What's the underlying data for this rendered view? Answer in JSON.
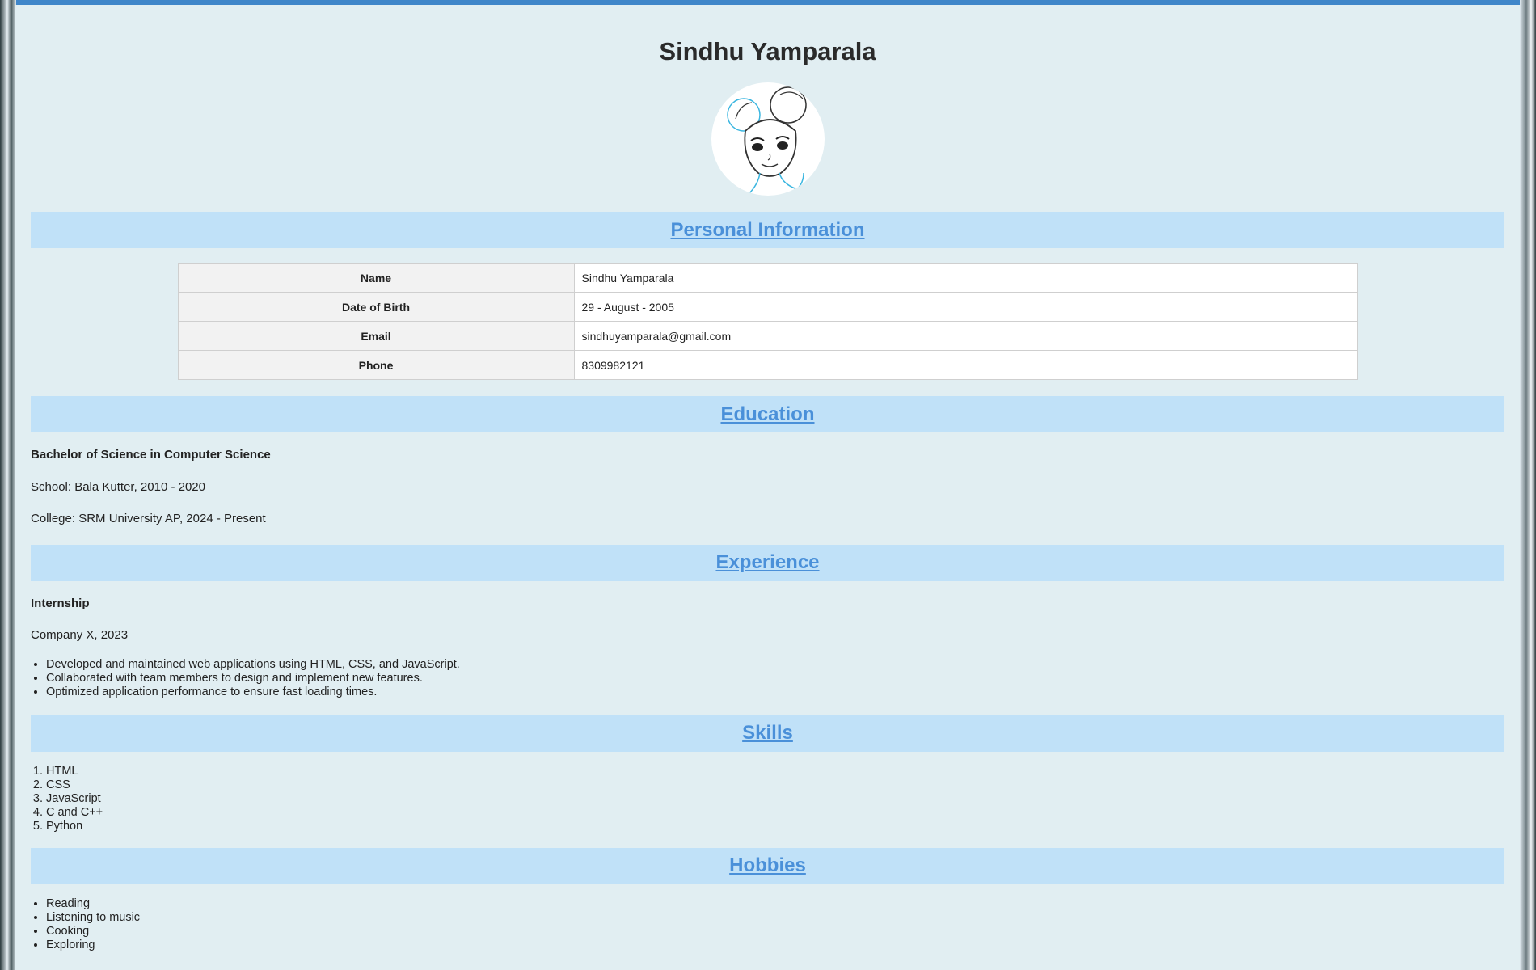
{
  "name": "Sindhu Yamparala",
  "sections": {
    "personal": "Personal Information",
    "education": "Education",
    "experience": "Experience",
    "skills": "Skills",
    "hobbies": "Hobbies"
  },
  "personal_info": [
    {
      "label": "Name",
      "value": "Sindhu Yamparala"
    },
    {
      "label": "Date of Birth",
      "value": "29 - August - 2005"
    },
    {
      "label": "Email",
      "value": "sindhuyamparala@gmail.com"
    },
    {
      "label": "Phone",
      "value": "8309982121"
    }
  ],
  "education": {
    "degree": "Bachelor of Science in Computer Science",
    "school": "School: Bala Kutter, 2010 - 2020",
    "college": "College: SRM University AP, 2024 - Present"
  },
  "experience": {
    "title": "Internship",
    "company": "Company X, 2023",
    "points": [
      "Developed and maintained web applications using HTML, CSS, and JavaScript.",
      "Collaborated with team members to design and implement new features.",
      "Optimized application performance to ensure fast loading times."
    ]
  },
  "skills": [
    "HTML",
    "CSS",
    "JavaScript",
    "C and C++",
    "Python"
  ],
  "hobbies": [
    "Reading",
    "Listening to music",
    "Cooking",
    "Exploring"
  ],
  "colors": {
    "section_bg": "#c0e1f8",
    "section_link": "#4a90d9",
    "page_bg": "#e1eef2"
  },
  "icons": {
    "avatar": "cartoon-girl-portrait"
  }
}
